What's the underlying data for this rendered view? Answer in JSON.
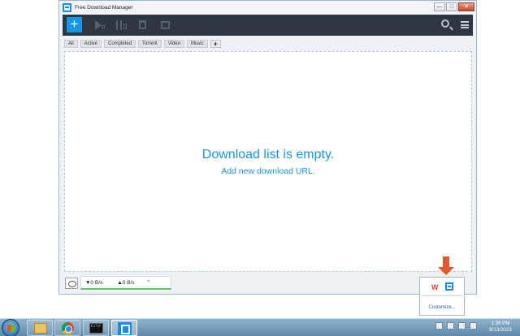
{
  "window": {
    "title": "Free Download Manager",
    "minimize": "—",
    "maximize": "□",
    "close": "✕"
  },
  "toolbar": {
    "add_label": "+"
  },
  "filters": [
    "All",
    "Active",
    "Completed",
    "Torrent",
    "Video",
    "Music"
  ],
  "filter_add": "+",
  "empty": {
    "title": "Download list is empty.",
    "link": "Add new download URL."
  },
  "status": {
    "download_speed": "▼0 B/s",
    "upload_speed": "▲0 B/s",
    "chevron": "⌃"
  },
  "tray_popup": {
    "customize": "Customize..."
  },
  "taskbar": {
    "time": "1:36 PM",
    "date": "8/13/2023"
  },
  "colors": {
    "accent": "#1a93dc",
    "toolbar_bg": "#2e3641",
    "arrow": "#e2572c"
  }
}
